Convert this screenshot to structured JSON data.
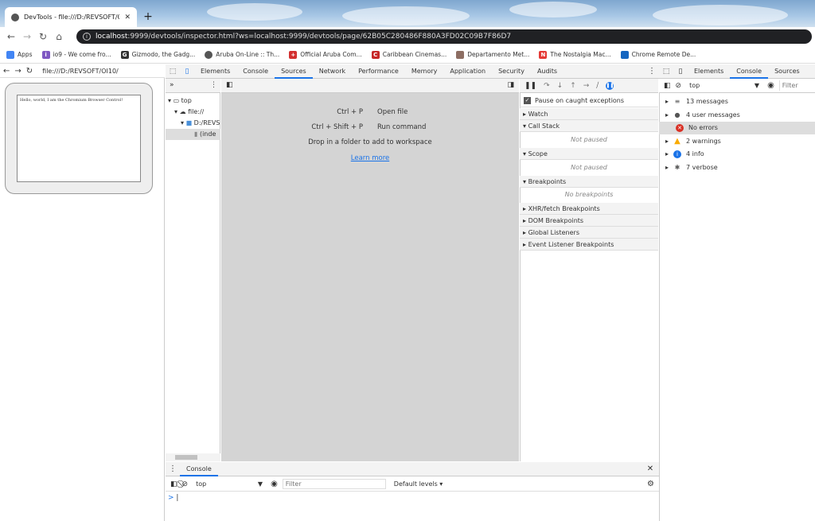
{
  "browser": {
    "tab_title": "DevTools - file:///D:/REVSOFT/OI",
    "url_host": "localhost",
    "url_rest": ":9999/devtools/inspector.html?ws=localhost:9999/devtools/page/62B05C280486F880A3FD02C09B7F86D7",
    "bookmarks": [
      {
        "label": "Apps",
        "color": "#e8453c"
      },
      {
        "label": "io9 - We come fro...",
        "color": "#7e57c2"
      },
      {
        "label": "Gizmodo, the Gadg...",
        "color": "#333333"
      },
      {
        "label": "Aruba On-Line :: Th...",
        "color": "#555555"
      },
      {
        "label": "Official Aruba Com...",
        "color": "#d32f2f"
      },
      {
        "label": "Caribbean Cinemas...",
        "color": "#c62828"
      },
      {
        "label": "Departamento Met...",
        "color": "#8d6e63"
      },
      {
        "label": "The Nostalgia Mac...",
        "color": "#e53935"
      },
      {
        "label": "Chrome Remote De...",
        "color": "#1565c0"
      }
    ]
  },
  "left": {
    "url": "file:///D:/REVSOFT/OI10/",
    "page_text": "Hello, world, I am the Chromium Browser Control!"
  },
  "devtools": {
    "tabs": [
      "Elements",
      "Console",
      "Sources",
      "Network",
      "Performance",
      "Memory",
      "Application",
      "Security",
      "Audits"
    ],
    "active_tab": "Sources",
    "tree": {
      "top": "top",
      "file": "file://",
      "folder": "D:/REVS",
      "file_item": "(inde"
    },
    "editor": {
      "open_file_keys": "Ctrl + P",
      "open_file": "Open file",
      "run_cmd_keys": "Ctrl + Shift + P",
      "run_cmd": "Run command",
      "drop": "Drop in a folder to add to workspace",
      "learn_more": "Learn more"
    },
    "sidebar": {
      "pause_label": "Pause on caught exceptions",
      "watch": "Watch",
      "call_stack": "Call Stack",
      "not_paused_1": "Not paused",
      "scope": "Scope",
      "not_paused_2": "Not paused",
      "breakpoints": "Breakpoints",
      "no_breakpoints": "No breakpoints",
      "xhr": "XHR/fetch Breakpoints",
      "dom": "DOM Breakpoints",
      "global": "Global Listeners",
      "event": "Event Listener Breakpoints"
    },
    "drawer": {
      "tab": "Console",
      "context": "top",
      "filter_placeholder": "Filter",
      "levels": "Default levels ▾",
      "prompt": ">"
    }
  },
  "right_devtools": {
    "tabs": [
      "Elements",
      "Console",
      "Sources"
    ],
    "active_tab": "Console",
    "context": "top",
    "filter_placeholder": "Filter",
    "rows": [
      {
        "label": "13 messages",
        "icon": "≡",
        "color": "#555555"
      },
      {
        "label": "4 user messages",
        "icon": "●",
        "color": "#555555"
      },
      {
        "label": "No errors",
        "icon": "✕",
        "color": "#d93025"
      },
      {
        "label": "2 warnings",
        "icon": "▲",
        "color": "#f9ab00"
      },
      {
        "label": "4 info",
        "icon": "i",
        "color": "#1a73e8"
      },
      {
        "label": "7 verbose",
        "icon": "✱",
        "color": "#555555"
      }
    ]
  }
}
